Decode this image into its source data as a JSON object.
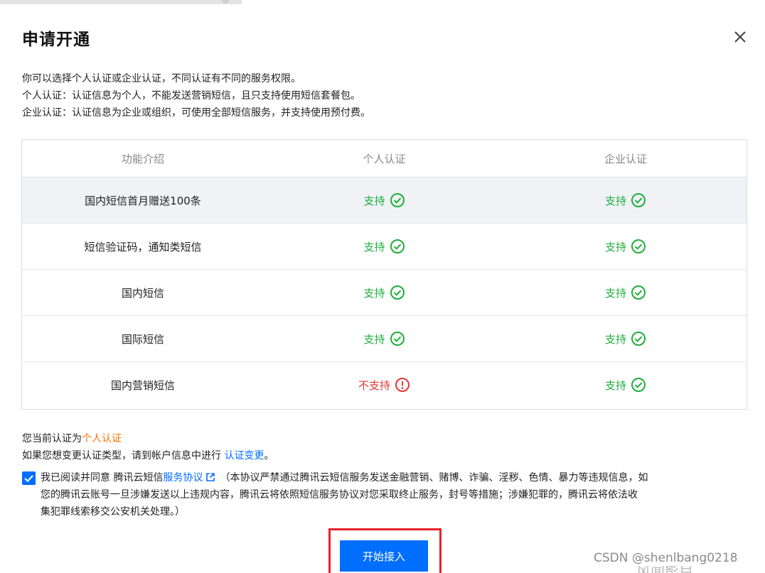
{
  "dialog": {
    "title": "申请开通",
    "intro": [
      "你可以选择个人认证或企业认证，不同认证有不同的服务权限。",
      "个人认证：认证信息为个人，不能发送营销短信，且只支持使用短信套餐包。",
      "企业认证：认证信息为企业或组织，可使用全部短信服务，并支持使用预付费。"
    ]
  },
  "table": {
    "headers": [
      "功能介绍",
      "个人认证",
      "企业认证"
    ],
    "rows": [
      {
        "feature": "国内短信首月赠送100条",
        "personal": "支持",
        "enterprise": "支持"
      },
      {
        "feature": "短信验证码，通知类短信",
        "personal": "支持",
        "enterprise": "支持"
      },
      {
        "feature": "国内短信",
        "personal": "支持",
        "enterprise": "支持"
      },
      {
        "feature": "国际短信",
        "personal": "支持",
        "enterprise": "支持"
      },
      {
        "feature": "国内营销短信",
        "personal": "不支持",
        "enterprise": "支持"
      }
    ]
  },
  "current": {
    "prefix": "您当前认证为",
    "value": "个人认证",
    "change_prefix": "如果您想变更认证类型，请到帐户信息中进行 ",
    "change_link": "认证变更",
    "change_suffix": "。"
  },
  "agreement": {
    "checked": true,
    "prefix": "我已阅读并同意 腾讯云短信",
    "link": "服务协议",
    "line1_rest": "（本协议严禁通过腾讯云短信服务发送金融营销、赌博、诈骗、淫秽、色情、暴力等违规信息，如",
    "line2": "您的腾讯云账号一旦涉嫌发送以上违规内容，腾讯云将依照短信服务协议对您采取终止服务，封号等措施；涉嫌犯罪的，腾讯云将依法收",
    "line3": "集犯罪线索移交公安机关处理。）"
  },
  "button": {
    "label": "开始接入"
  },
  "watermark": {
    "text": "CSDN @shenlbang0218",
    "text2": "风闻影目"
  },
  "colors": {
    "primary": "#006eff",
    "success": "#1eae3a",
    "danger": "#e53535",
    "orange": "#ff7200",
    "highlight_box": "#e8212b"
  },
  "icons": {
    "close": "close-icon",
    "ok": "check-circle-icon",
    "no": "exclamation-circle-icon",
    "external": "external-link-icon",
    "check": "checkmark-icon"
  }
}
